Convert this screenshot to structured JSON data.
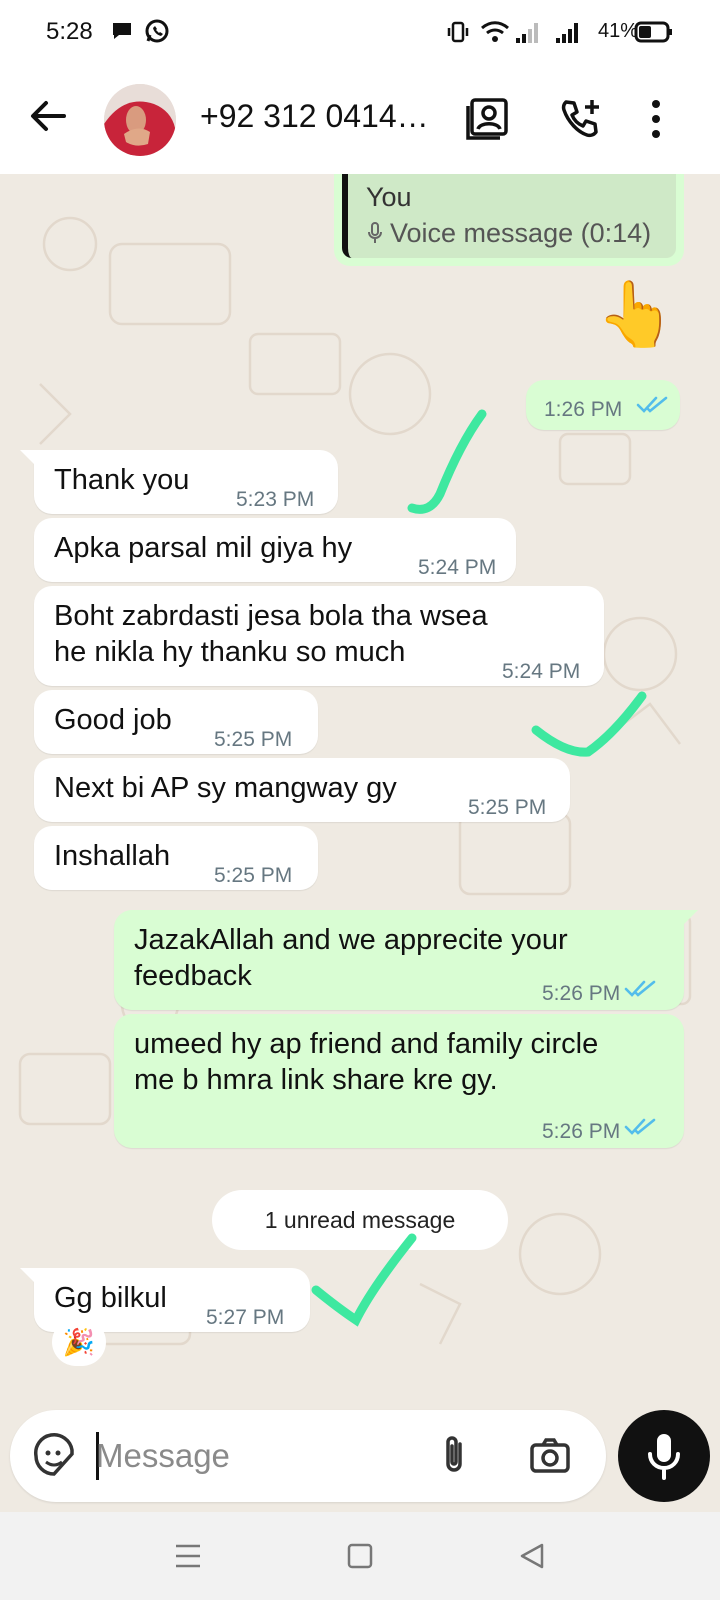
{
  "status_bar": {
    "time": "5:28",
    "battery": "41%",
    "icons": [
      "chat-bubble-icon",
      "whatsapp-icon",
      "vibrate-icon",
      "wifi-icon",
      "signal-icon",
      "signal-icon",
      "battery-icon"
    ]
  },
  "header": {
    "contact": "+92 312 0414…",
    "icons": [
      "back-arrow-icon",
      "avatar",
      "contact-card-icon",
      "add-call-icon",
      "more-vert-icon"
    ]
  },
  "quoted": {
    "sender": "You",
    "body": "Voice message (0:14)"
  },
  "messages": [
    {
      "dir": "out",
      "emoji": "👆",
      "time": "1:26 PM"
    },
    {
      "dir": "in",
      "text": "Thank you",
      "time": "5:23 PM"
    },
    {
      "dir": "in",
      "text": "Apka parsal mil giya hy",
      "time": "5:24 PM"
    },
    {
      "dir": "in",
      "lines": [
        "Boht zabrdasti jesa bola tha wsea",
        "he nikla hy thanku so much"
      ],
      "time": "5:24 PM"
    },
    {
      "dir": "in",
      "text": "Good job",
      "time": "5:25 PM"
    },
    {
      "dir": "in",
      "text": "Next bi AP sy mangway gy",
      "time": "5:25 PM"
    },
    {
      "dir": "in",
      "text": "Inshallah",
      "time": "5:25 PM"
    },
    {
      "dir": "out",
      "lines": [
        "JazakAllah and we apprecite your",
        "feedback"
      ],
      "time": "5:26 PM"
    },
    {
      "dir": "out",
      "lines": [
        "umeed hy ap friend and family circle",
        "me b hmra link share kre gy."
      ],
      "time": "5:26 PM"
    },
    {
      "dir": "in",
      "text": "Gg bilkul",
      "time": "5:27 PM",
      "reaction": "🎉"
    }
  ],
  "unread_divider": "1 unread message",
  "input": {
    "placeholder": "Message",
    "icons": [
      "sticker-icon",
      "attach-icon",
      "camera-icon",
      "mic-icon"
    ]
  },
  "nav": {
    "icons": [
      "menu-icon",
      "home-square-icon",
      "back-triangle-icon"
    ]
  },
  "colors": {
    "chat_bg": "#efeae2",
    "incoming_bubble": "#ffffff",
    "outgoing_bubble": "#d9fdd3",
    "read_ticks": "#53bdeb",
    "annotation_check": "#3ee8a0",
    "mic_button": "#111111"
  }
}
